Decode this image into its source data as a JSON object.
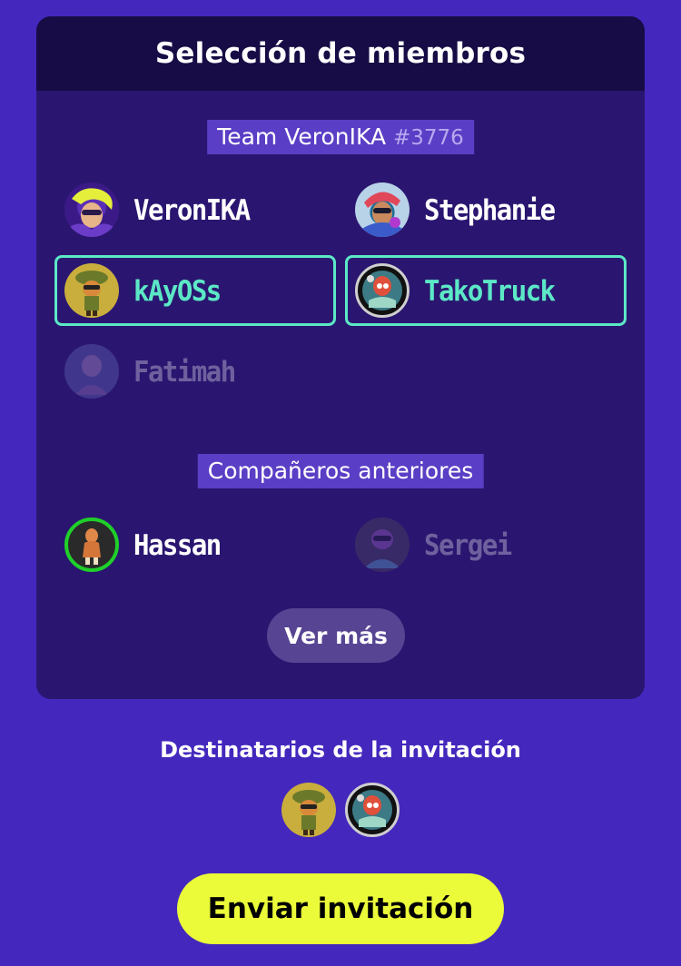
{
  "panel": {
    "title": "Selección de miembros",
    "team": {
      "name": "Team VeronIKA",
      "tag": "#3776"
    },
    "team_members": [
      {
        "name": "VeronIKA",
        "selected": false,
        "disabled": false,
        "avatar": "avatar-veronika"
      },
      {
        "name": "Stephanie",
        "selected": false,
        "disabled": false,
        "avatar": "avatar-stephanie"
      },
      {
        "name": "kAyOSs",
        "selected": true,
        "disabled": false,
        "avatar": "avatar-kayoss"
      },
      {
        "name": "TakoTruck",
        "selected": true,
        "disabled": false,
        "avatar": "avatar-takotruck"
      },
      {
        "name": "Fatimah",
        "selected": false,
        "disabled": true,
        "avatar": "avatar-fatimah"
      }
    ],
    "previous_label": "Compañeros anteriores",
    "previous_members": [
      {
        "name": "Hassan",
        "selected": false,
        "disabled": false,
        "online": true,
        "avatar": "avatar-hassan"
      },
      {
        "name": "Sergei",
        "selected": false,
        "disabled": true,
        "avatar": "avatar-sergei"
      }
    ],
    "more_label": "Ver más"
  },
  "recipients": {
    "label": "Destinatarios de la invitación",
    "avatars": [
      "avatar-kayoss",
      "avatar-takotruck"
    ]
  },
  "send_label": "Enviar invitación",
  "colors": {
    "background": "#4428bd",
    "panel": "#2a1670",
    "header": "#170c45",
    "selected_border": "#5ce8c6",
    "send_button": "#ebfb39",
    "online_ring": "#1fcf2a"
  }
}
